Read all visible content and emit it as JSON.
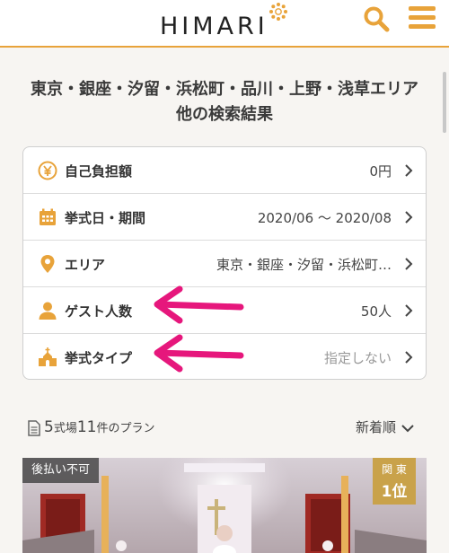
{
  "header": {
    "logo_text": "HIMARI",
    "icons": {
      "logo": "sun-flower-icon",
      "search": "search-icon",
      "menu": "hamburger-menu-icon"
    },
    "accent_color": "#e8a33a"
  },
  "page_title": "東京・銀座・汐留・浜松町・品川・上野・浅草エリア 他の検索結果",
  "conditions": [
    {
      "icon": "yen-coin-icon",
      "label": "自己負担額",
      "value": "0円",
      "muted": false
    },
    {
      "icon": "calendar-icon",
      "label": "挙式日・期間",
      "value": "2020/06 〜 2020/08",
      "muted": false
    },
    {
      "icon": "map-pin-icon",
      "label": "エリア",
      "value": "東京・銀座・汐留・浜松町…",
      "muted": false
    },
    {
      "icon": "person-icon",
      "label": "ゲスト人数",
      "value": "50人",
      "muted": false
    },
    {
      "icon": "chapel-icon",
      "label": "挙式タイプ",
      "value": "指定しない",
      "muted": true
    }
  ],
  "annotation_color": "#e6177c",
  "results": {
    "count_venues": "5",
    "unit_venues": "式場",
    "count_plans": "11",
    "unit_plans": "件のプラン",
    "sort_label": "新着順"
  },
  "card": {
    "badge": "後払い不可",
    "rank_region": "関 東",
    "rank": "1位"
  }
}
